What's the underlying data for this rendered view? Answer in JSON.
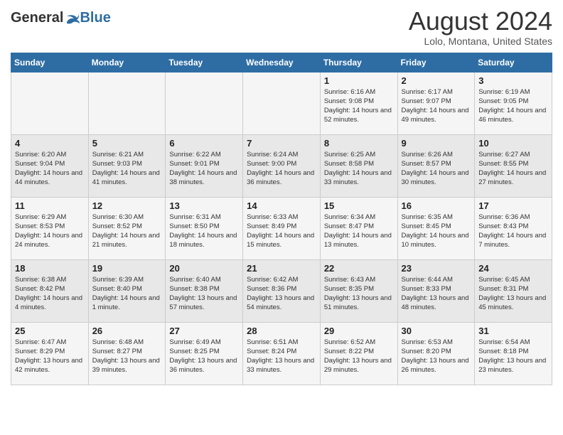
{
  "header": {
    "logo_general": "General",
    "logo_blue": "Blue",
    "month_year": "August 2024",
    "location": "Lolo, Montana, United States"
  },
  "days_of_week": [
    "Sunday",
    "Monday",
    "Tuesday",
    "Wednesday",
    "Thursday",
    "Friday",
    "Saturday"
  ],
  "weeks": [
    [
      {
        "day": "",
        "sunrise": "",
        "sunset": "",
        "daylight": ""
      },
      {
        "day": "",
        "sunrise": "",
        "sunset": "",
        "daylight": ""
      },
      {
        "day": "",
        "sunrise": "",
        "sunset": "",
        "daylight": ""
      },
      {
        "day": "",
        "sunrise": "",
        "sunset": "",
        "daylight": ""
      },
      {
        "day": "1",
        "sunrise": "Sunrise: 6:16 AM",
        "sunset": "Sunset: 9:08 PM",
        "daylight": "Daylight: 14 hours and 52 minutes."
      },
      {
        "day": "2",
        "sunrise": "Sunrise: 6:17 AM",
        "sunset": "Sunset: 9:07 PM",
        "daylight": "Daylight: 14 hours and 49 minutes."
      },
      {
        "day": "3",
        "sunrise": "Sunrise: 6:19 AM",
        "sunset": "Sunset: 9:05 PM",
        "daylight": "Daylight: 14 hours and 46 minutes."
      }
    ],
    [
      {
        "day": "4",
        "sunrise": "Sunrise: 6:20 AM",
        "sunset": "Sunset: 9:04 PM",
        "daylight": "Daylight: 14 hours and 44 minutes."
      },
      {
        "day": "5",
        "sunrise": "Sunrise: 6:21 AM",
        "sunset": "Sunset: 9:03 PM",
        "daylight": "Daylight: 14 hours and 41 minutes."
      },
      {
        "day": "6",
        "sunrise": "Sunrise: 6:22 AM",
        "sunset": "Sunset: 9:01 PM",
        "daylight": "Daylight: 14 hours and 38 minutes."
      },
      {
        "day": "7",
        "sunrise": "Sunrise: 6:24 AM",
        "sunset": "Sunset: 9:00 PM",
        "daylight": "Daylight: 14 hours and 36 minutes."
      },
      {
        "day": "8",
        "sunrise": "Sunrise: 6:25 AM",
        "sunset": "Sunset: 8:58 PM",
        "daylight": "Daylight: 14 hours and 33 minutes."
      },
      {
        "day": "9",
        "sunrise": "Sunrise: 6:26 AM",
        "sunset": "Sunset: 8:57 PM",
        "daylight": "Daylight: 14 hours and 30 minutes."
      },
      {
        "day": "10",
        "sunrise": "Sunrise: 6:27 AM",
        "sunset": "Sunset: 8:55 PM",
        "daylight": "Daylight: 14 hours and 27 minutes."
      }
    ],
    [
      {
        "day": "11",
        "sunrise": "Sunrise: 6:29 AM",
        "sunset": "Sunset: 8:53 PM",
        "daylight": "Daylight: 14 hours and 24 minutes."
      },
      {
        "day": "12",
        "sunrise": "Sunrise: 6:30 AM",
        "sunset": "Sunset: 8:52 PM",
        "daylight": "Daylight: 14 hours and 21 minutes."
      },
      {
        "day": "13",
        "sunrise": "Sunrise: 6:31 AM",
        "sunset": "Sunset: 8:50 PM",
        "daylight": "Daylight: 14 hours and 18 minutes."
      },
      {
        "day": "14",
        "sunrise": "Sunrise: 6:33 AM",
        "sunset": "Sunset: 8:49 PM",
        "daylight": "Daylight: 14 hours and 15 minutes."
      },
      {
        "day": "15",
        "sunrise": "Sunrise: 6:34 AM",
        "sunset": "Sunset: 8:47 PM",
        "daylight": "Daylight: 14 hours and 13 minutes."
      },
      {
        "day": "16",
        "sunrise": "Sunrise: 6:35 AM",
        "sunset": "Sunset: 8:45 PM",
        "daylight": "Daylight: 14 hours and 10 minutes."
      },
      {
        "day": "17",
        "sunrise": "Sunrise: 6:36 AM",
        "sunset": "Sunset: 8:43 PM",
        "daylight": "Daylight: 14 hours and 7 minutes."
      }
    ],
    [
      {
        "day": "18",
        "sunrise": "Sunrise: 6:38 AM",
        "sunset": "Sunset: 8:42 PM",
        "daylight": "Daylight: 14 hours and 4 minutes."
      },
      {
        "day": "19",
        "sunrise": "Sunrise: 6:39 AM",
        "sunset": "Sunset: 8:40 PM",
        "daylight": "Daylight: 14 hours and 1 minute."
      },
      {
        "day": "20",
        "sunrise": "Sunrise: 6:40 AM",
        "sunset": "Sunset: 8:38 PM",
        "daylight": "Daylight: 13 hours and 57 minutes."
      },
      {
        "day": "21",
        "sunrise": "Sunrise: 6:42 AM",
        "sunset": "Sunset: 8:36 PM",
        "daylight": "Daylight: 13 hours and 54 minutes."
      },
      {
        "day": "22",
        "sunrise": "Sunrise: 6:43 AM",
        "sunset": "Sunset: 8:35 PM",
        "daylight": "Daylight: 13 hours and 51 minutes."
      },
      {
        "day": "23",
        "sunrise": "Sunrise: 6:44 AM",
        "sunset": "Sunset: 8:33 PM",
        "daylight": "Daylight: 13 hours and 48 minutes."
      },
      {
        "day": "24",
        "sunrise": "Sunrise: 6:45 AM",
        "sunset": "Sunset: 8:31 PM",
        "daylight": "Daylight: 13 hours and 45 minutes."
      }
    ],
    [
      {
        "day": "25",
        "sunrise": "Sunrise: 6:47 AM",
        "sunset": "Sunset: 8:29 PM",
        "daylight": "Daylight: 13 hours and 42 minutes."
      },
      {
        "day": "26",
        "sunrise": "Sunrise: 6:48 AM",
        "sunset": "Sunset: 8:27 PM",
        "daylight": "Daylight: 13 hours and 39 minutes."
      },
      {
        "day": "27",
        "sunrise": "Sunrise: 6:49 AM",
        "sunset": "Sunset: 8:25 PM",
        "daylight": "Daylight: 13 hours and 36 minutes."
      },
      {
        "day": "28",
        "sunrise": "Sunrise: 6:51 AM",
        "sunset": "Sunset: 8:24 PM",
        "daylight": "Daylight: 13 hours and 33 minutes."
      },
      {
        "day": "29",
        "sunrise": "Sunrise: 6:52 AM",
        "sunset": "Sunset: 8:22 PM",
        "daylight": "Daylight: 13 hours and 29 minutes."
      },
      {
        "day": "30",
        "sunrise": "Sunrise: 6:53 AM",
        "sunset": "Sunset: 8:20 PM",
        "daylight": "Daylight: 13 hours and 26 minutes."
      },
      {
        "day": "31",
        "sunrise": "Sunrise: 6:54 AM",
        "sunset": "Sunset: 8:18 PM",
        "daylight": "Daylight: 13 hours and 23 minutes."
      }
    ]
  ]
}
